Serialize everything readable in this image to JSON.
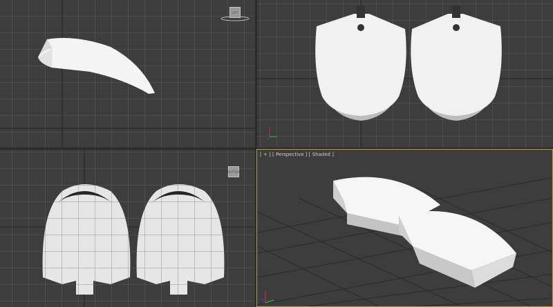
{
  "viewports": {
    "top_left": {
      "viewcube_label": "LEFT"
    },
    "top_right": {},
    "bottom_left": {
      "viewcube_label": "BOTTOM"
    },
    "bottom_right": {
      "label": "[ + ] [ Perspective ] [ Shaded ]",
      "active": true
    }
  },
  "colors": {
    "background": "#3d3d3d",
    "grid": "#5a5a5a",
    "active_border": "#b8a53a",
    "model": "#f2f2f2"
  }
}
